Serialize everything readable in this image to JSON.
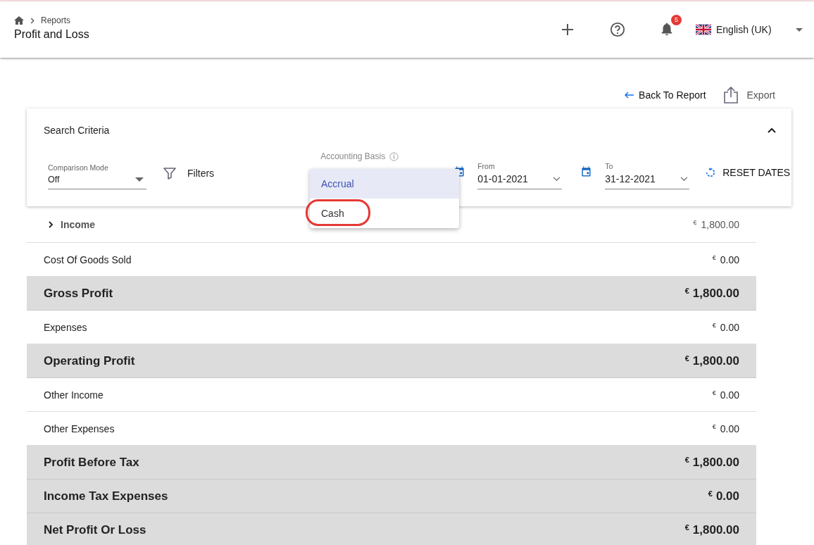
{
  "breadcrumb": {
    "parent": "Reports",
    "title": "Profit and Loss"
  },
  "header": {
    "notification_count": "5",
    "language": "English (UK)"
  },
  "actions": {
    "back": "Back To Report",
    "export": "Export"
  },
  "search_criteria": {
    "title": "Search Criteria",
    "expanded": true,
    "comparison_mode": {
      "label": "Comparison Mode",
      "value": "Off"
    },
    "filters": "Filters",
    "accounting_basis": {
      "label": "Accounting Basis",
      "options": [
        {
          "label": "Accrual",
          "selected": true,
          "circled": false
        },
        {
          "label": "Cash",
          "selected": false,
          "circled": true
        }
      ]
    },
    "from": {
      "label": "From",
      "value": "01-01-2021"
    },
    "to": {
      "label": "To",
      "value": "31-12-2021"
    },
    "reset": "RESET DATES"
  },
  "rows": [
    {
      "kind": "line",
      "label": "Income",
      "currency": "€",
      "amount": "1,800.00",
      "expandable": true
    },
    {
      "kind": "line",
      "label": "Cost Of Goods Sold",
      "currency": "€",
      "amount": "0.00",
      "expandable": false
    },
    {
      "kind": "total",
      "label": "Gross Profit",
      "currency": "€",
      "amount": "1,800.00",
      "expandable": false
    },
    {
      "kind": "line",
      "label": "Expenses",
      "currency": "€",
      "amount": "0.00",
      "expandable": false
    },
    {
      "kind": "total",
      "label": "Operating Profit",
      "currency": "€",
      "amount": "1,800.00",
      "expandable": false
    },
    {
      "kind": "line",
      "label": "Other Income",
      "currency": "€",
      "amount": "0.00",
      "expandable": false
    },
    {
      "kind": "line",
      "label": "Other Expenses",
      "currency": "€",
      "amount": "0.00",
      "expandable": false
    },
    {
      "kind": "total",
      "label": "Profit Before Tax",
      "currency": "€",
      "amount": "1,800.00",
      "expandable": false
    },
    {
      "kind": "total",
      "label": "Income Tax Expenses",
      "currency": "€",
      "amount": "0.00",
      "expandable": false
    },
    {
      "kind": "total",
      "label": "Net Profit Or Loss",
      "currency": "€",
      "amount": "1,800.00",
      "expandable": false
    }
  ]
}
